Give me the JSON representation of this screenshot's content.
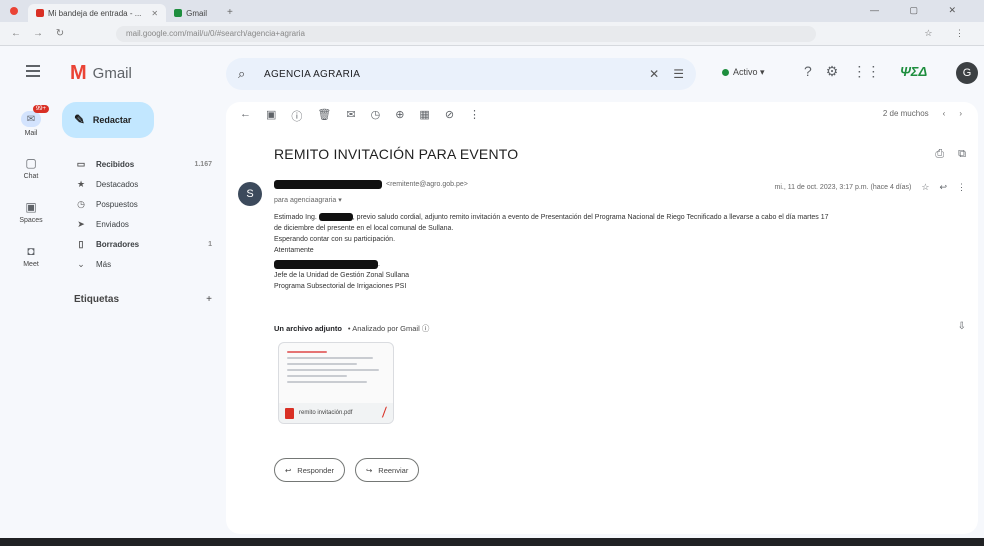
{
  "browser": {
    "tabs": [
      {
        "label": "Mi bandeja de entrada - ...",
        "active": true
      },
      {
        "label": "Gmail",
        "active": false
      }
    ],
    "new_tab": "+",
    "url": "mail.google.com/mail/u/0/#search/agencia+agraria",
    "window_controls": "— ▢ ✕"
  },
  "gmail": {
    "logo_letter": "M",
    "logo_word": "Gmail",
    "search": {
      "value": "AGENCIA AGRARIA",
      "clear_icon": "✕",
      "options_icon": "☰"
    },
    "status_label": "Activo ▾",
    "header_icons": [
      "?",
      "⚙",
      "⋮⋮"
    ],
    "brand_mark": "ΨΣΔ",
    "account_initial": "G"
  },
  "rail": [
    {
      "label": "Mail",
      "icon": "envelope-icon",
      "glyph": "✉",
      "badge": "99+"
    },
    {
      "label": "Chat",
      "icon": "chat-icon",
      "glyph": "▢"
    },
    {
      "label": "Spaces",
      "icon": "spaces-icon",
      "glyph": "▣"
    },
    {
      "label": "Meet",
      "icon": "video-icon",
      "glyph": "◘"
    }
  ],
  "sidebar": {
    "compose_label": "Redactar",
    "folders": [
      {
        "label": "Recibidos",
        "count": "1.167",
        "glyph": "▭",
        "icon": "inbox-icon",
        "bold": true
      },
      {
        "label": "Destacados",
        "count": "",
        "glyph": "★",
        "icon": "star-icon",
        "bold": false
      },
      {
        "label": "Pospuestos",
        "count": "",
        "glyph": "◷",
        "icon": "clock-icon",
        "bold": false
      },
      {
        "label": "Enviados",
        "count": "",
        "glyph": "➤",
        "icon": "send-icon",
        "bold": false
      },
      {
        "label": "Borradores",
        "count": "1",
        "glyph": "▯",
        "icon": "draft-icon",
        "bold": true
      },
      {
        "label": "Más",
        "count": "",
        "glyph": "⌄",
        "icon": "chevron-down-icon",
        "bold": false
      }
    ],
    "labels_heading": "Etiquetas",
    "labels_add": "+"
  },
  "toolbar": {
    "icons": [
      "←",
      "▣",
      "ⓘ",
      "🗑",
      "✉",
      "◷",
      "⊕",
      "▦",
      "⊘",
      "⋮"
    ],
    "pager": "2 de muchos",
    "prev": "‹",
    "next": "›"
  },
  "email": {
    "subject": "REMITO INVITACIÓN PARA EVENTO",
    "subject_icons": [
      "⎙",
      "⧉"
    ],
    "sender_initial": "S",
    "sender_suffix": "<remitente@agro.gob.pe>",
    "to": "para agenciaagraria ▾",
    "date": "mi., 11 de oct. 2023, 3:17 p.m. (hace 4 días)",
    "date_icons": [
      "☆",
      "↩",
      "⋮"
    ],
    "greeting_prefix": "Estimado Ing.",
    "greeting_rest": ", previo saludo cordial, adjunto remito invitación a evento de Presentación del Programa Nacional de Riego Tecnificado a llevarse a cabo el día martes 17",
    "body_line2": "de diciembre del presente en el local comunal de Sullana.",
    "body_line3": "Esperando contar con su participación.",
    "body_line4": "Atentamente",
    "signature_suffix": ".",
    "signature_role": "Jefe de la Unidad de Gestión Zonal Sullana",
    "signature_org": "Programa Subsectorial de Irrigaciones PSI"
  },
  "attachment": {
    "heading_bold": "Un archivo adjunto",
    "heading_rest": "• Analizado por Gmail ⓘ",
    "download_icon": "⇩",
    "filename": "remito invitación.pdf",
    "acrobat": "⟋"
  },
  "actions": {
    "reply": "Responder",
    "forward": "Reenviar",
    "reply_icon": "↩",
    "forward_icon": "↪"
  }
}
